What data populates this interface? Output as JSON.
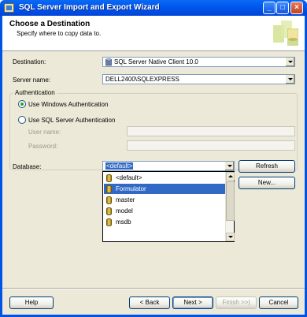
{
  "window": {
    "title": "SQL Server Import and Export Wizard"
  },
  "header": {
    "title": "Choose a Destination",
    "subtitle": "Specify where to copy data to."
  },
  "form": {
    "destination_label": "Destination:",
    "destination_value": "SQL Server Native Client 10.0",
    "server_label": "Server name:",
    "server_value": "DELL2400\\SQLEXPRESS",
    "auth_group_label": "Authentication",
    "windows_auth_label": "Use Windows Authentication",
    "sql_auth_label": "Use SQL Server Authentication",
    "username_label": "User name:",
    "password_label": "Password:",
    "database_label": "Database:",
    "database_value": "<default>",
    "selected_auth": "windows"
  },
  "database_options": [
    "<default>",
    "Formulator",
    "master",
    "model",
    "msdb"
  ],
  "database_highlighted": "Formulator",
  "buttons": {
    "refresh": "Refresh",
    "new": "New...",
    "help": "Help",
    "back": "< Back",
    "next": "Next >",
    "finish": "Finish >>|",
    "cancel": "Cancel"
  }
}
